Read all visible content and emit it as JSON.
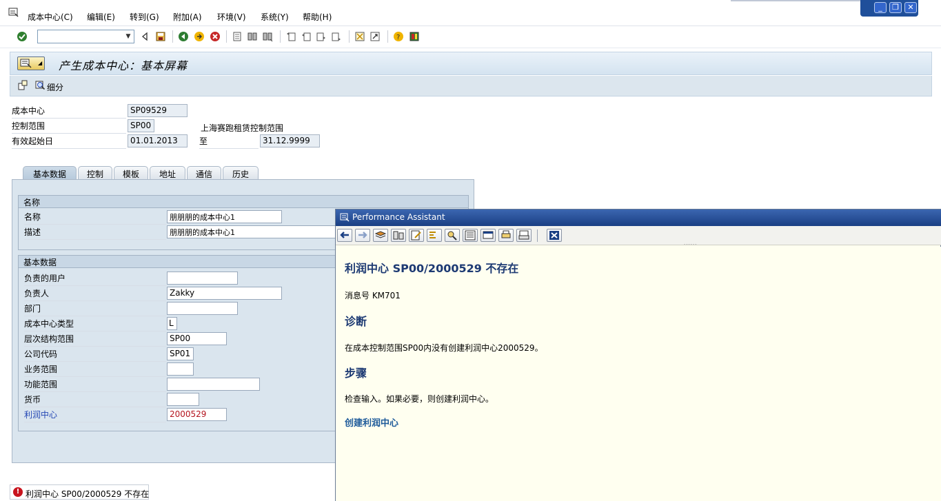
{
  "menubar": {
    "items": [
      "成本中心(C)",
      "编辑(E)",
      "转到(G)",
      "附加(A)",
      "环境(V)",
      "系统(Y)",
      "帮助(H)"
    ],
    "window_buttons": [
      "_",
      "❐",
      "✕"
    ]
  },
  "toolbar": {
    "command_value": ""
  },
  "header": {
    "title": "产生成本中心：基本屏幕",
    "detail_label": "细分"
  },
  "fields": {
    "cost_center_label": "成本中心",
    "cost_center_value": "SP09529",
    "control_area_label": "控制范围",
    "control_area_value": "SP00",
    "control_area_desc": "上海赛跑租赁控制范围",
    "valid_from_label": "有效起始日",
    "valid_from_value": "01.01.2013",
    "to_label": "至",
    "valid_to_value": "31.12.9999"
  },
  "tabs": [
    "基本数据",
    "控制",
    "模板",
    "地址",
    "通信",
    "历史"
  ],
  "group_names": {
    "title": "名称",
    "rows": [
      {
        "label": "名称",
        "value": "朋朋朋的成本中心1"
      },
      {
        "label": "描述",
        "value": "朋朋朋的成本中心1"
      }
    ]
  },
  "group_basic": {
    "title": "基本数据",
    "rows": [
      {
        "label": "负责的用户",
        "value": ""
      },
      {
        "label": "负责人",
        "value": "Zakky"
      },
      {
        "label": "部门",
        "value": ""
      },
      {
        "label": "成本中心类型",
        "value": "L"
      },
      {
        "label": "层次结构范围",
        "value": "SP00"
      },
      {
        "label": "公司代码",
        "value": "SP01"
      },
      {
        "label": "业务范围",
        "value": ""
      },
      {
        "label": "功能范围",
        "value": ""
      },
      {
        "label": "货币",
        "value": ""
      },
      {
        "label": "利润中心",
        "value": "2000529"
      }
    ]
  },
  "status": {
    "message": "利润中心 SP00/2000529 不存在"
  },
  "assistant": {
    "title": "Performance Assistant",
    "heading": "利润中心  SP00/2000529 不存在",
    "msg_no": "消息号  KM701",
    "diag_heading": "诊断",
    "diag_text": "在成本控制范围SP00内没有创建利润中心2000529。",
    "steps_heading": "步骤",
    "steps_text": "检查输入。如果必要，则创建利润中心。",
    "link": "创建利润中心"
  },
  "colors": {
    "accent": "#1d3a73",
    "error": "#c8141e",
    "link": "#1d5a9a",
    "profit_label": "#2346b4",
    "profit_value": "#b4141e"
  }
}
